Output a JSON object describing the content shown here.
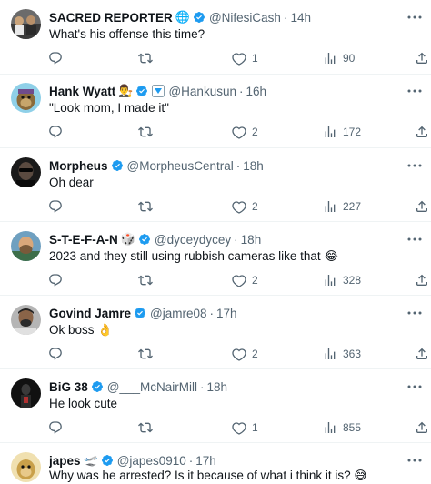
{
  "tweets": [
    {
      "name": "SACRED REPORTER",
      "handle": "@NifesiCash",
      "time": "14h",
      "text": "What's his offense this time?",
      "replies": "",
      "retweets": "",
      "likes": "1",
      "views": "90",
      "extra_icon": "globe-icon",
      "avatar_icon": "group-photo-avatar"
    },
    {
      "name": "Hank Wyatt",
      "handle": "@Hankusun",
      "time": "16h",
      "text": "\"Look mom, I made it\"",
      "replies": "",
      "retweets": "",
      "likes": "2",
      "views": "172",
      "extra_icon": "judge-emoji",
      "avatar_icon": "cartoon-ape-avatar"
    },
    {
      "name": "Morpheus",
      "handle": "@MorpheusCentral",
      "time": "18h",
      "text": "Oh dear",
      "replies": "",
      "retweets": "",
      "likes": "2",
      "views": "227",
      "avatar_icon": "sunglasses-man-avatar"
    },
    {
      "name": "S-T-E-F-A-N",
      "handle": "@dyceydycey",
      "time": "18h",
      "text": "2023 and they still using rubbish cameras like that",
      "text_emoji": "😂",
      "replies": "",
      "retweets": "",
      "likes": "2",
      "views": "328",
      "extra_icon": "dice-emoji",
      "avatar_icon": "bearded-man-avatar"
    },
    {
      "name": "Govind Jamre",
      "handle": "@jamre08",
      "time": "17h",
      "text": "Ok boss",
      "text_emoji": "👌",
      "replies": "",
      "retweets": "",
      "likes": "2",
      "views": "363",
      "avatar_icon": "man-portrait-avatar"
    },
    {
      "name": "BiG 38",
      "handle": "@___McNairMill",
      "time": "18h",
      "text": "He look cute",
      "replies": "",
      "retweets": "",
      "likes": "1",
      "views": "855",
      "avatar_icon": "dark-figure-avatar"
    },
    {
      "name": "japes",
      "handle": "@japes0910",
      "time": "17h",
      "text": "Why was he arrested? Is it because of what i think it is?",
      "text_emoji": "😅",
      "replies": "",
      "retweets": "",
      "likes": "",
      "views": "",
      "extra_icon": "airplane-emoji",
      "avatar_icon": "cartoon-ape-avatar"
    }
  ],
  "colors": {
    "verified": "#1d9bf0",
    "text_primary": "#0f1419",
    "text_secondary": "#536471",
    "divider": "#eff3f4"
  },
  "extra_glyphs": {
    "globe": "🌐",
    "judge": "👨‍⚖️",
    "dice": "🎲",
    "airplane": "🛫"
  }
}
